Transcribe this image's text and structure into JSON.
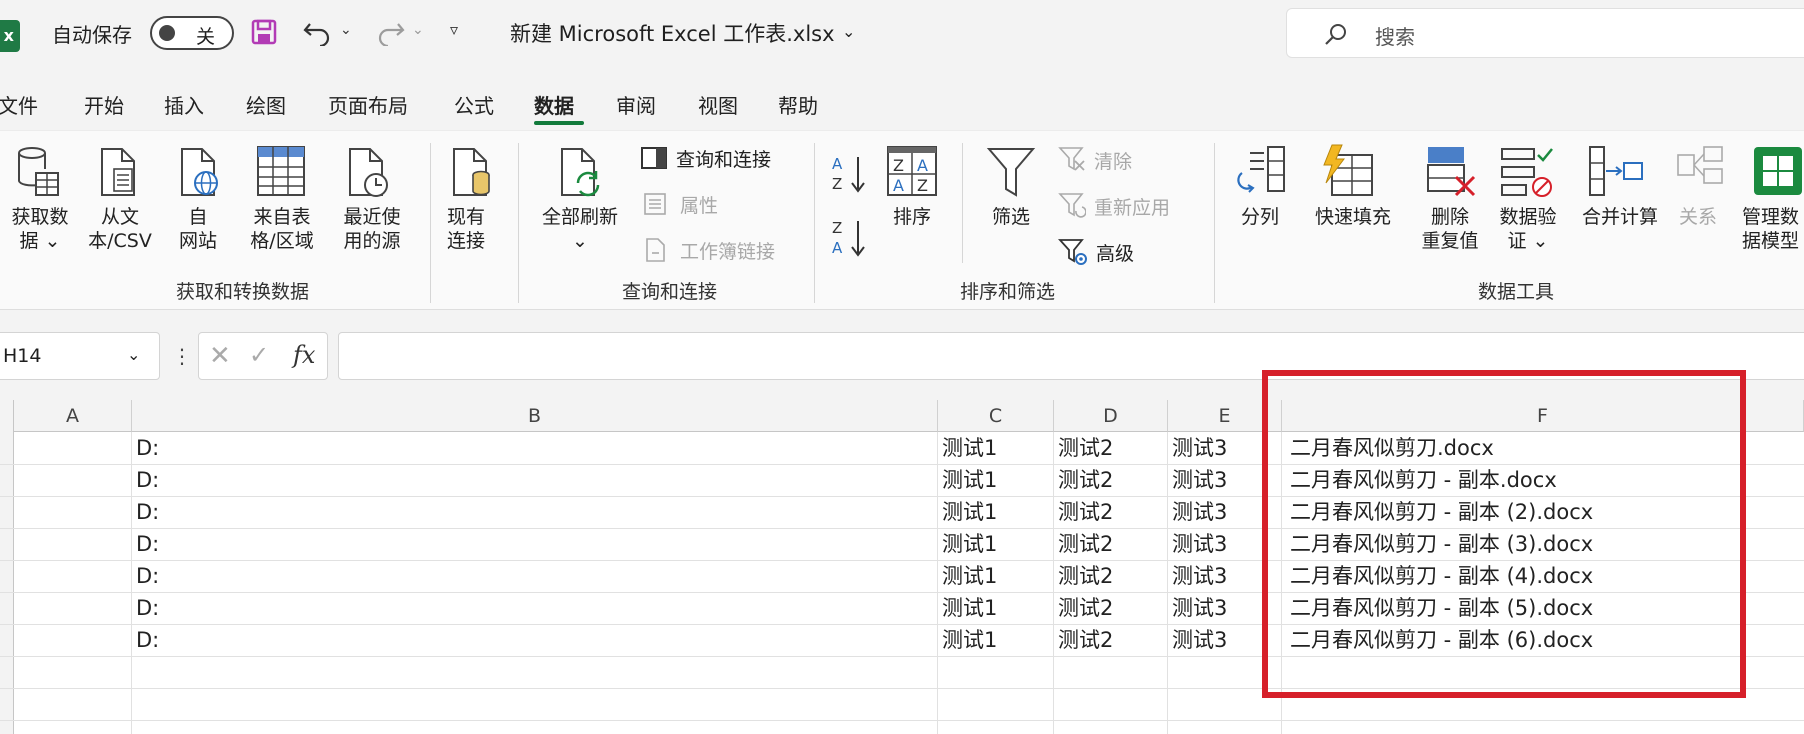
{
  "titlebar": {
    "autosave_label": "自动保存",
    "autosave_state": "关",
    "document_title": "新建 Microsoft Excel 工作表.xlsx",
    "search_placeholder": "搜索"
  },
  "menu_tabs": [
    "文件",
    "开始",
    "插入",
    "绘图",
    "页面布局",
    "公式",
    "数据",
    "审阅",
    "视图",
    "帮助"
  ],
  "active_tab": "数据",
  "ribbon": {
    "get_transform": {
      "get_data_1": "获取数",
      "get_data_2": "据",
      "from_text_1": "从文",
      "from_text_2": "本/CSV",
      "from_web_1": "自",
      "from_web_2": "网站",
      "from_table_1": "来自表",
      "from_table_2": "格/区域",
      "recent_sources_1": "最近使",
      "recent_sources_2": "用的源",
      "existing_conn_1": "现有",
      "existing_conn_2": "连接",
      "group_label": "获取和转换数据"
    },
    "queries": {
      "refresh_all": "全部刷新",
      "queries_connections": "查询和连接",
      "properties": "属性",
      "workbook_links": "工作簿链接",
      "group_label": "查询和连接"
    },
    "sort_filter": {
      "sort": "排序",
      "filter": "筛选",
      "clear": "清除",
      "reapply": "重新应用",
      "advanced": "高级",
      "group_label": "排序和筛选"
    },
    "data_tools": {
      "text_to_columns": "分列",
      "flash_fill": "快速填充",
      "remove_dup_1": "删除",
      "remove_dup_2": "重复值",
      "validation_1": "数据验",
      "validation_2": "证",
      "consolidate": "合并计算",
      "relationships": "关系",
      "data_model_1": "管理数",
      "data_model_2": "据模型",
      "group_label": "数据工具"
    }
  },
  "formula_bar": {
    "name_box": "H14",
    "fx": "fx",
    "formula": ""
  },
  "grid": {
    "columns": [
      "A",
      "B",
      "C",
      "D",
      "E",
      "F"
    ],
    "rows": [
      {
        "b": "D:",
        "c": "测试1",
        "d": "测试2",
        "e": "测试3",
        "f": "二月春风似剪刀.docx"
      },
      {
        "b": "D:",
        "c": "测试1",
        "d": "测试2",
        "e": "测试3",
        "f": "二月春风似剪刀 - 副本.docx"
      },
      {
        "b": "D:",
        "c": "测试1",
        "d": "测试2",
        "e": "测试3",
        "f": "二月春风似剪刀 - 副本 (2).docx"
      },
      {
        "b": "D:",
        "c": "测试1",
        "d": "测试2",
        "e": "测试3",
        "f": "二月春风似剪刀 - 副本 (3).docx"
      },
      {
        "b": "D:",
        "c": "测试1",
        "d": "测试2",
        "e": "测试3",
        "f": "二月春风似剪刀 - 副本 (4).docx"
      },
      {
        "b": "D:",
        "c": "测试1",
        "d": "测试2",
        "e": "测试3",
        "f": "二月春风似剪刀 - 副本 (5).docx"
      },
      {
        "b": "D:",
        "c": "测试1",
        "d": "测试2",
        "e": "测试3",
        "f": "二月春风似剪刀 - 副本 (6).docx"
      }
    ]
  },
  "colors": {
    "excel_green": "#117a3b",
    "highlight_red": "#d6202a",
    "save_purple": "#b23bb5"
  },
  "icons": [
    "excel-logo",
    "save-icon",
    "undo-icon",
    "redo-icon",
    "search-icon"
  ]
}
